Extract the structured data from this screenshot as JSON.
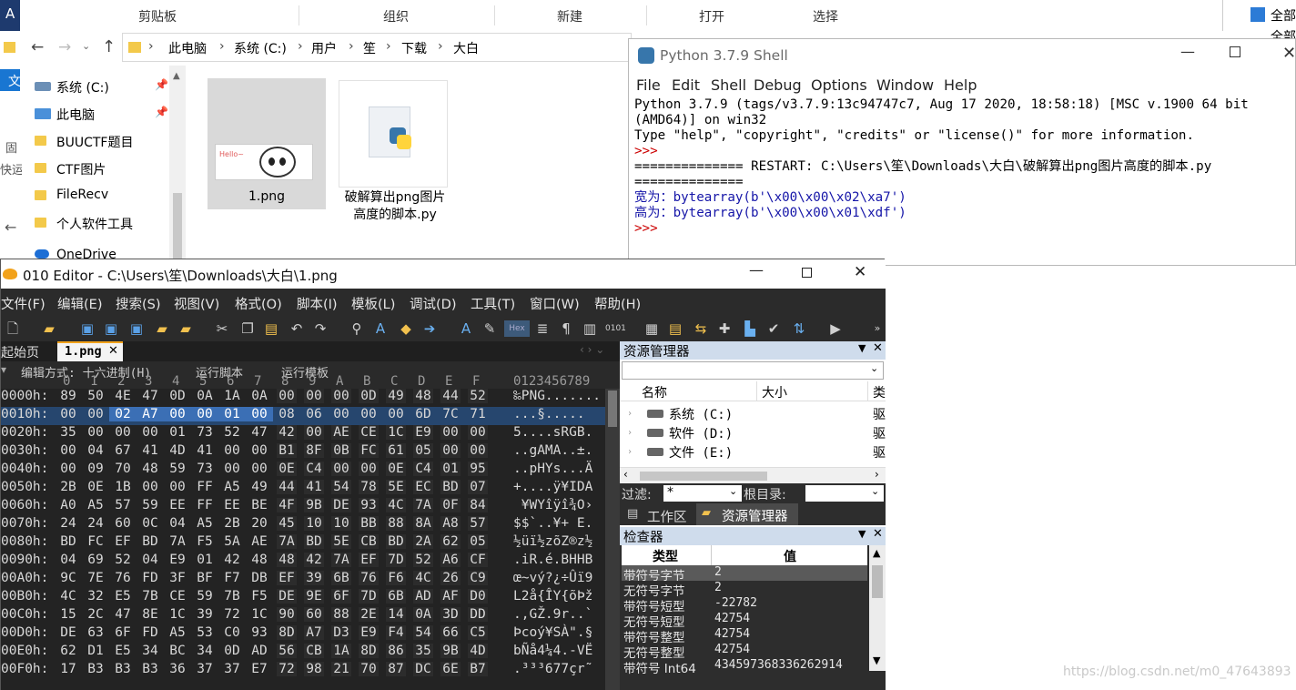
{
  "explorer": {
    "ribbon_groups": [
      "剪贴板",
      "组织",
      "新建",
      "打开",
      "选择"
    ],
    "ribbon_right": [
      "全部",
      "全部"
    ],
    "left_letters": [
      "A",
      "文",
      "固",
      "快运"
    ],
    "breadcrumb": [
      "此电脑",
      "系统 (C:)",
      "用户",
      "笙",
      "下载",
      "大白"
    ],
    "nav_items": [
      "系统 (C:)",
      "此电脑",
      "BUUCTF题目",
      "CTF图片",
      "FileRecv",
      "个人软件工具",
      "OneDrive"
    ],
    "files": [
      {
        "name": "1.png"
      },
      {
        "name": "破解算出png图片高度的脚本.py"
      }
    ]
  },
  "python_shell": {
    "title": "Python 3.7.9 Shell",
    "menu": [
      "File",
      "Edit",
      "Shell",
      "Debug",
      "Options",
      "Window",
      "Help"
    ],
    "lines": [
      "Python 3.7.9 (tags/v3.7.9:13c94747c7, Aug 17 2020, 18:58:18) [MSC v.1900 64 bit",
      "(AMD64)] on win32",
      "Type \"help\", \"copyright\", \"credits\" or \"license()\" for more information.",
      ">>> ",
      "============== RESTART: C:\\Users\\笙\\Downloads\\大白\\破解算出png图片高度的脚本.py",
      "==============",
      "宽为：bytearray(b'\\x00\\x00\\x02\\xa7')",
      "高为：bytearray(b'\\x00\\x00\\x01\\xdf')",
      ">>> "
    ]
  },
  "editor": {
    "title": "010 Editor - C:\\Users\\笙\\Downloads\\大白\\1.png",
    "menu": [
      "文件(F)",
      "编辑(E)",
      "搜索(S)",
      "视图(V)",
      "格式(O)",
      "脚本(I)",
      "模板(L)",
      "调试(D)",
      "工具(T)",
      "窗口(W)",
      "帮助(H)"
    ],
    "tabs": [
      "起始页",
      "1.png"
    ],
    "hex_options": [
      "编辑方式: 十六进制(H)",
      "运行脚本",
      "运行模板"
    ],
    "col_header": [
      "0",
      "1",
      "2",
      "3",
      "4",
      "5",
      "6",
      "7",
      "8",
      "9",
      "A",
      "B",
      "C",
      "D",
      "E",
      "F"
    ],
    "ascii_header": "0123456789",
    "rows": [
      {
        "addr": "0000h:",
        "bytes": [
          "89",
          "50",
          "4E",
          "47",
          "0D",
          "0A",
          "1A",
          "0A",
          "00",
          "00",
          "00",
          "0D",
          "49",
          "48",
          "44",
          "52"
        ],
        "ascii": "‰PNG......."
      },
      {
        "addr": "0010h:",
        "bytes": [
          "00",
          "00",
          "02",
          "A7",
          "00",
          "00",
          "01",
          "00",
          "08",
          "06",
          "00",
          "00",
          "00",
          "6D",
          "7C",
          "71"
        ],
        "ascii": "...§....."
      },
      {
        "addr": "0020h:",
        "bytes": [
          "35",
          "00",
          "00",
          "00",
          "01",
          "73",
          "52",
          "47",
          "42",
          "00",
          "AE",
          "CE",
          "1C",
          "E9",
          "00",
          "00"
        ],
        "ascii": "5....sRGB."
      },
      {
        "addr": "0030h:",
        "bytes": [
          "00",
          "04",
          "67",
          "41",
          "4D",
          "41",
          "00",
          "00",
          "B1",
          "8F",
          "0B",
          "FC",
          "61",
          "05",
          "00",
          "00"
        ],
        "ascii": "..gAMA..±."
      },
      {
        "addr": "0040h:",
        "bytes": [
          "00",
          "09",
          "70",
          "48",
          "59",
          "73",
          "00",
          "00",
          "0E",
          "C4",
          "00",
          "00",
          "0E",
          "C4",
          "01",
          "95"
        ],
        "ascii": "..pHYs...Ä"
      },
      {
        "addr": "0050h:",
        "bytes": [
          "2B",
          "0E",
          "1B",
          "00",
          "00",
          "FF",
          "A5",
          "49",
          "44",
          "41",
          "54",
          "78",
          "5E",
          "EC",
          "BD",
          "07"
        ],
        "ascii": "+....ÿ¥IDA"
      },
      {
        "addr": "0060h:",
        "bytes": [
          "A0",
          "A5",
          "57",
          "59",
          "EE",
          "FF",
          "EE",
          "BE",
          "4F",
          "9B",
          "DE",
          "93",
          "4C",
          "7A",
          "0F",
          "84"
        ],
        "ascii": " ¥WYîÿî¾O›"
      },
      {
        "addr": "0070h:",
        "bytes": [
          "24",
          "24",
          "60",
          "0C",
          "04",
          "A5",
          "2B",
          "20",
          "45",
          "10",
          "10",
          "BB",
          "88",
          "8A",
          "A8",
          "57"
        ],
        "ascii": "$$`..¥+ E."
      },
      {
        "addr": "0080h:",
        "bytes": [
          "BD",
          "FC",
          "EF",
          "BD",
          "7A",
          "F5",
          "5A",
          "AE",
          "7A",
          "BD",
          "5E",
          "CB",
          "BD",
          "2A",
          "62",
          "05"
        ],
        "ascii": "½üï½zõZ®z½"
      },
      {
        "addr": "0090h:",
        "bytes": [
          "04",
          "69",
          "52",
          "04",
          "E9",
          "01",
          "42",
          "48",
          "48",
          "42",
          "7A",
          "EF",
          "7D",
          "52",
          "A6",
          "CF"
        ],
        "ascii": ".iR.é.BHHB"
      },
      {
        "addr": "00A0h:",
        "bytes": [
          "9C",
          "7E",
          "76",
          "FD",
          "3F",
          "BF",
          "F7",
          "DB",
          "EF",
          "39",
          "6B",
          "76",
          "F6",
          "4C",
          "26",
          "C9"
        ],
        "ascii": "œ~vý?¿÷Ûï9"
      },
      {
        "addr": "00B0h:",
        "bytes": [
          "4C",
          "32",
          "E5",
          "7B",
          "CE",
          "59",
          "7B",
          "F5",
          "DE",
          "9E",
          "6F",
          "7D",
          "6B",
          "AD",
          "AF",
          "D0"
        ],
        "ascii": "L2å{ÎY{õÞž"
      },
      {
        "addr": "00C0h:",
        "bytes": [
          "15",
          "2C",
          "47",
          "8E",
          "1C",
          "39",
          "72",
          "1C",
          "90",
          "60",
          "88",
          "2E",
          "14",
          "0A",
          "3D",
          "DD"
        ],
        "ascii": ".,GŽ.9r..`"
      },
      {
        "addr": "00D0h:",
        "bytes": [
          "DE",
          "63",
          "6F",
          "FD",
          "A5",
          "53",
          "C0",
          "93",
          "8D",
          "A7",
          "D3",
          "E9",
          "F4",
          "54",
          "66",
          "C5"
        ],
        "ascii": "Þcoý¥SÀ\".§"
      },
      {
        "addr": "00E0h:",
        "bytes": [
          "62",
          "D1",
          "E5",
          "34",
          "BC",
          "34",
          "0D",
          "AD",
          "56",
          "CB",
          "1A",
          "8D",
          "86",
          "35",
          "9B",
          "4D"
        ],
        "ascii": "bÑå4¼4.-VË"
      },
      {
        "addr": "00F0h:",
        "bytes": [
          "17",
          "B3",
          "B3",
          "B3",
          "36",
          "37",
          "37",
          "E7",
          "72",
          "98",
          "21",
          "70",
          "87",
          "DC",
          "6E",
          "B7"
        ],
        "ascii": ".³³³677çr˜"
      }
    ],
    "resource_manager": {
      "title": "资源管理器",
      "columns": [
        "名称",
        "大小",
        "类"
      ],
      "drives": [
        {
          "name": "系统 (C:)",
          "type": "驱"
        },
        {
          "name": "软件 (D:)",
          "type": "驱"
        },
        {
          "name": "文件 (E:)",
          "type": "驱"
        }
      ],
      "filter_label": "过滤:",
      "filter_value": "*",
      "root_label": "根目录:",
      "tabs": [
        "工作区",
        "资源管理器"
      ]
    },
    "inspector": {
      "title": "检查器",
      "columns": [
        "类型",
        "值"
      ],
      "rows": [
        {
          "type": "带符号字节",
          "value": "2"
        },
        {
          "type": "无符号字节",
          "value": "2"
        },
        {
          "type": "带符号短型",
          "value": "-22782"
        },
        {
          "type": "无符号短型",
          "value": "42754"
        },
        {
          "type": "带符号整型",
          "value": "42754"
        },
        {
          "type": "无符号整型",
          "value": "42754"
        },
        {
          "type": "带符号 Int64",
          "value": "434597368336262914"
        }
      ]
    }
  },
  "watermark": "https://blog.csdn.net/m0_47643893"
}
